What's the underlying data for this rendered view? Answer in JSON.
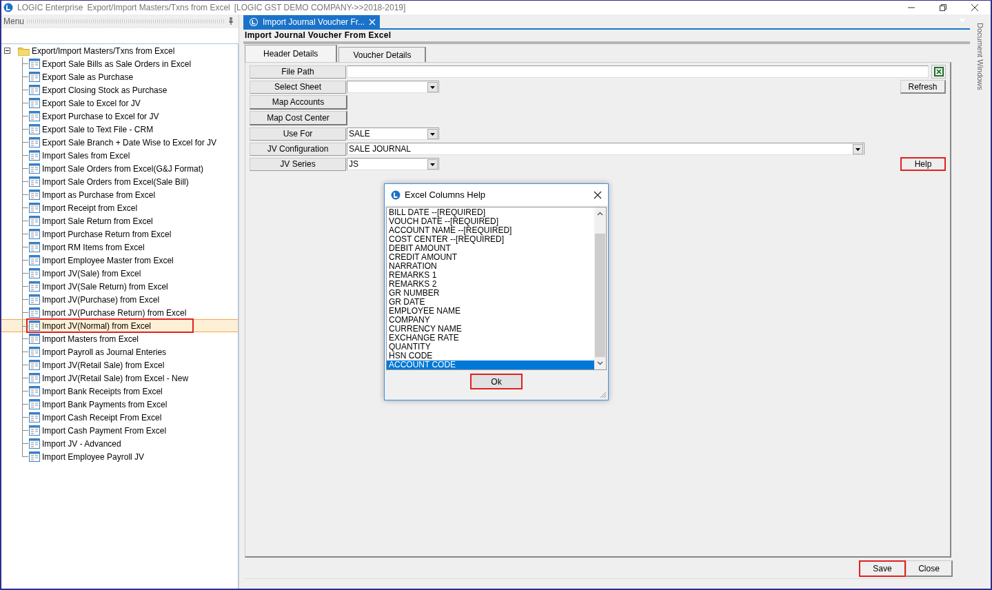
{
  "window": {
    "app": "LOGIC Enterprise",
    "title": "Export/Import Masters/Txns from Excel",
    "company": "[LOGIC GST DEMO COMPANY->>2018-2019]"
  },
  "menu_panel": {
    "title": "Menu",
    "tree": {
      "label": "Export/Import Masters/Txns from Excel",
      "expanded": true,
      "children": [
        {
          "label": "Export Sale Bills as Sale Orders in Excel",
          "selected": false,
          "highlighted": false
        },
        {
          "label": "Export Sale as Purchase",
          "selected": false,
          "highlighted": false
        },
        {
          "label": "Export Closing Stock as Purchase",
          "selected": false,
          "highlighted": false
        },
        {
          "label": "Export Sale to Excel for JV",
          "selected": false,
          "highlighted": false
        },
        {
          "label": "Export Purchase to Excel for JV",
          "selected": false,
          "highlighted": false
        },
        {
          "label": "Export Sale to Text File - CRM",
          "selected": false,
          "highlighted": false
        },
        {
          "label": "Export Sale Branch + Date Wise to Excel for JV",
          "selected": false,
          "highlighted": false
        },
        {
          "label": "Import Sales from Excel",
          "selected": false,
          "highlighted": false
        },
        {
          "label": "Import Sale Orders from Excel(G&J Format)",
          "selected": false,
          "highlighted": false
        },
        {
          "label": "Import Sale Orders from Excel(Sale Bill)",
          "selected": false,
          "highlighted": false
        },
        {
          "label": "Import as Purchase from Excel",
          "selected": false,
          "highlighted": false
        },
        {
          "label": "Import Receipt from Excel",
          "selected": false,
          "highlighted": false
        },
        {
          "label": "Import Sale Return from Excel",
          "selected": false,
          "highlighted": false
        },
        {
          "label": "Import Purchase Return from Excel",
          "selected": false,
          "highlighted": false
        },
        {
          "label": "Import RM Items from Excel",
          "selected": false,
          "highlighted": false
        },
        {
          "label": "Import Employee Master from Excel",
          "selected": false,
          "highlighted": false
        },
        {
          "label": "Import JV(Sale) from Excel",
          "selected": false,
          "highlighted": false
        },
        {
          "label": "Import JV(Sale Return) from Excel",
          "selected": false,
          "highlighted": false
        },
        {
          "label": "Import JV(Purchase) from Excel",
          "selected": false,
          "highlighted": false
        },
        {
          "label": "Import JV(Purchase Return) from Excel",
          "selected": false,
          "highlighted": false
        },
        {
          "label": "Import JV(Normal) from Excel",
          "selected": true,
          "highlighted": true
        },
        {
          "label": "Import Masters from Excel",
          "selected": false,
          "highlighted": false
        },
        {
          "label": "Import Payroll as Journal Enteries",
          "selected": false,
          "highlighted": false
        },
        {
          "label": "Import JV(Retail Sale) from Excel",
          "selected": false,
          "highlighted": false
        },
        {
          "label": "Import JV(Retail Sale) from Excel - New",
          "selected": false,
          "highlighted": false
        },
        {
          "label": "Import Bank Receipts from Excel",
          "selected": false,
          "highlighted": false
        },
        {
          "label": "Import Bank Payments from Excel",
          "selected": false,
          "highlighted": false
        },
        {
          "label": "Import Cash Receipt From Excel",
          "selected": false,
          "highlighted": false
        },
        {
          "label": "Import Cash Payment From Excel",
          "selected": false,
          "highlighted": false
        },
        {
          "label": "Import JV - Advanced",
          "selected": false,
          "highlighted": false
        },
        {
          "label": "Import Employee Payroll JV",
          "selected": false,
          "highlighted": false
        }
      ]
    }
  },
  "document_tab": {
    "label": "Import Journal Voucher Fr...",
    "selected": true
  },
  "side_panel": {
    "label": "Document Windows"
  },
  "form": {
    "heading": "Import Journal Voucher From Excel",
    "tabs": [
      {
        "label": "Header Details",
        "selected": true
      },
      {
        "label": "Voucher Details",
        "selected": false
      }
    ],
    "rows": [
      {
        "kind": "input",
        "label": "File Path",
        "value": "",
        "excel_button": true
      },
      {
        "kind": "dropdown",
        "label": "Select Sheet",
        "value": "",
        "wide": false,
        "action": {
          "label": "Refresh",
          "highlighted": false
        }
      },
      {
        "kind": "button",
        "label": "Map Accounts"
      },
      {
        "kind": "button",
        "label": "Map Cost Center"
      },
      {
        "kind": "dropdown",
        "label": "Use For",
        "value": "SALE",
        "wide": false
      },
      {
        "kind": "dropdown",
        "label": "JV Configuration",
        "value": "SALE JOURNAL",
        "wide": true
      },
      {
        "kind": "dropdown",
        "label": "JV Series",
        "value": "JS",
        "wide": false,
        "action": {
          "label": "Help",
          "highlighted": true
        }
      }
    ],
    "buttons": [
      {
        "label": "Save",
        "highlighted": true
      },
      {
        "label": "Close",
        "highlighted": false
      }
    ]
  },
  "dialog": {
    "title": "Excel Columns Help",
    "items": [
      {
        "label": "BILL DATE --[REQUIRED]",
        "selected": false
      },
      {
        "label": "VOUCH DATE --[REQUIRED]",
        "selected": false
      },
      {
        "label": "ACCOUNT NAME --[REQUIRED]",
        "selected": false
      },
      {
        "label": "COST CENTER --[REQUIRED]",
        "selected": false
      },
      {
        "label": "DEBIT AMOUNT",
        "selected": false
      },
      {
        "label": "CREDIT AMOUNT",
        "selected": false
      },
      {
        "label": "NARRATION",
        "selected": false
      },
      {
        "label": "REMARKS 1",
        "selected": false
      },
      {
        "label": "REMARKS 2",
        "selected": false
      },
      {
        "label": "GR NUMBER",
        "selected": false
      },
      {
        "label": "GR DATE",
        "selected": false
      },
      {
        "label": "EMPLOYEE NAME",
        "selected": false
      },
      {
        "label": "COMPANY",
        "selected": false
      },
      {
        "label": "CURRENCY NAME",
        "selected": false
      },
      {
        "label": "EXCHANGE RATE",
        "selected": false
      },
      {
        "label": "QUANTITY",
        "selected": false
      },
      {
        "label": "HSN CODE",
        "selected": false
      },
      {
        "label": "ACCOUNT CODE",
        "selected": true
      }
    ],
    "button": {
      "label": "Ok",
      "highlighted": true
    }
  }
}
